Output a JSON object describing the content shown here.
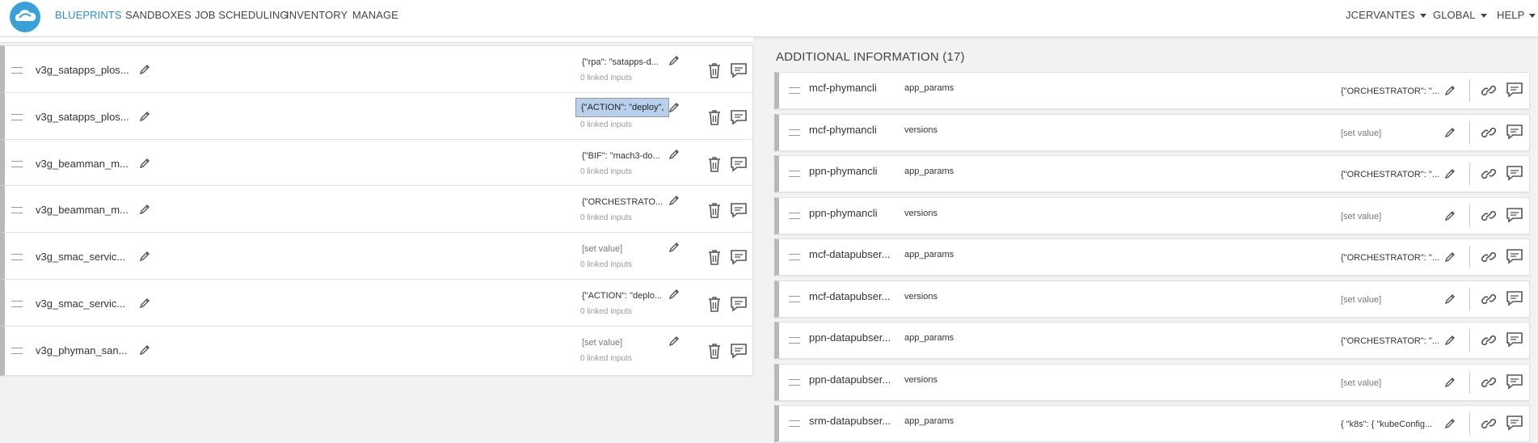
{
  "nav": {
    "logo": "cloud-logo-icon",
    "menu": [
      "BLUEPRINTS",
      "SANDBOXES",
      "JOB SCHEDULING",
      "INVENTORY",
      "MANAGE"
    ],
    "active": "BLUEPRINTS",
    "user": "JCERVANTES",
    "scope": "GLOBAL",
    "help": "HELP"
  },
  "left_rows": [
    {
      "name": "v3g_satapps_plos...",
      "value": "{\"rpa\": \"satapps-d...",
      "linked": "0 linked inputs"
    },
    {
      "name": "v3g_satapps_plos...",
      "value": "{\"ACTION\": \"deploy\",",
      "linked": "0 linked inputs",
      "selected": true
    },
    {
      "name": "v3g_beamman_m...",
      "value": "{\"BIF\": \"mach3-do...",
      "linked": "0 linked inputs"
    },
    {
      "name": "v3g_beamman_m...",
      "value": "{\"ORCHESTRATO...",
      "linked": "0 linked inputs"
    },
    {
      "name": "v3g_smac_servic...",
      "value": "[set value]",
      "linked": "0 linked inputs",
      "placeholder": true
    },
    {
      "name": "v3g_smac_servic...",
      "value": "{\"ACTION\": \"deplo...",
      "linked": "0 linked inputs"
    },
    {
      "name": "v3g_phyman_san...",
      "value": "[set value]",
      "linked": "0 linked inputs",
      "placeholder": true
    }
  ],
  "additional_info": {
    "title": "ADDITIONAL INFORMATION (17)",
    "rows": [
      {
        "name": "mcf-phymancli",
        "key": "app_params",
        "value": "{\"ORCHESTRATOR\": \"..."
      },
      {
        "name": "mcf-phymancli",
        "key": "versions",
        "value": "[set value]",
        "placeholder": true
      },
      {
        "name": "ppn-phymancli",
        "key": "app_params",
        "value": "{\"ORCHESTRATOR\": \"..."
      },
      {
        "name": "ppn-phymancli",
        "key": "versions",
        "value": "[set value]",
        "placeholder": true
      },
      {
        "name": "mcf-datapubser...",
        "key": "app_params",
        "value": "{\"ORCHESTRATOR\": \"..."
      },
      {
        "name": "mcf-datapubser...",
        "key": "versions",
        "value": "[set value]",
        "placeholder": true
      },
      {
        "name": "ppn-datapubser...",
        "key": "app_params",
        "value": "{\"ORCHESTRATOR\": \"..."
      },
      {
        "name": "ppn-datapubser...",
        "key": "versions",
        "value": "[set value]",
        "placeholder": true
      },
      {
        "name": "srm-datapubser...",
        "key": "app_params",
        "value": "{ \"k8s\": { \"kubeConfig..."
      }
    ]
  },
  "colors": {
    "accent": "#2a8fd4",
    "row_border": "#b8b8b8",
    "selection": "#b8d0ec",
    "logo": "#3aa0d8"
  }
}
